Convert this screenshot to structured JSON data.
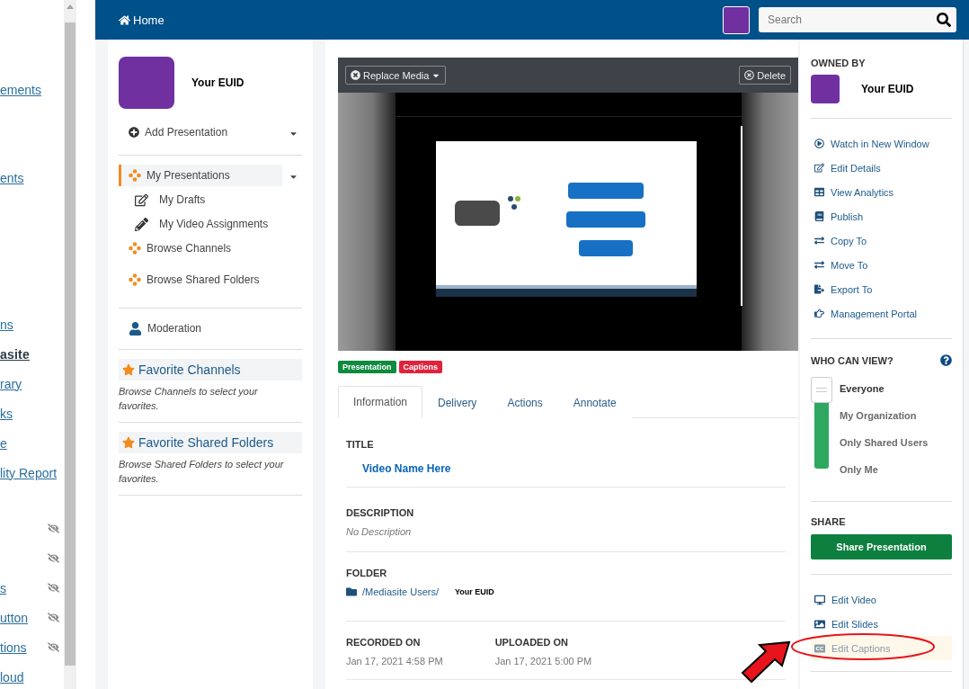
{
  "course_nav": {
    "items": [
      {
        "text": "ements",
        "selected": false,
        "hidden": false
      },
      {
        "text": "ents",
        "selected": false,
        "hidden": false
      },
      {
        "text": "ns",
        "selected": false,
        "hidden": false
      },
      {
        "text": "asite",
        "selected": true,
        "hidden": false
      },
      {
        "text": "rary",
        "selected": false,
        "hidden": false
      },
      {
        "text": "ks",
        "selected": false,
        "hidden": false
      },
      {
        "text": "e",
        "selected": false,
        "hidden": false
      },
      {
        "text": "lity Report",
        "selected": false,
        "hidden": false
      },
      {
        "hidden": true
      },
      {
        "hidden": true
      },
      {
        "text": "s",
        "selected": false,
        "hidden": true
      },
      {
        "text": "utton",
        "selected": false,
        "hidden": true
      },
      {
        "text": "tions",
        "selected": false,
        "hidden": true
      },
      {
        "text": "loud",
        "selected": false,
        "hidden": false
      }
    ]
  },
  "header": {
    "home": "Home",
    "search": {
      "placeholder": "Search"
    }
  },
  "left_panel": {
    "user": {
      "name": "Your EUID"
    },
    "sections": [
      [
        {
          "label": "Add Presentation",
          "kind": "add",
          "dropdown": true,
          "selected": false
        }
      ],
      [
        {
          "label": "My Presentations",
          "kind": "channel",
          "dropdown": true,
          "selected": true,
          "children": [
            {
              "label": "My Drafts",
              "kind": "draft",
              "selected": false
            },
            {
              "label": "My Video Assignments",
              "kind": "assignment",
              "selected": false
            }
          ]
        },
        {
          "label": "Browse Channels",
          "kind": "channel",
          "dropdown": false,
          "selected": false
        },
        {
          "label": "Browse Shared Folders",
          "kind": "channel",
          "dropdown": false,
          "selected": false
        }
      ],
      [
        {
          "label": "Moderation",
          "kind": "person",
          "dropdown": false,
          "selected": false
        }
      ]
    ],
    "favorites": [
      {
        "title": "Favorite Channels",
        "hint": "Browse Channels to select your favorites."
      },
      {
        "title": "Favorite Shared Folders",
        "hint": "Browse Shared Folders to select your favorites."
      }
    ]
  },
  "media": {
    "replace_button": "Replace Media",
    "delete_button": "Delete",
    "tags": [
      {
        "label": "Presentation",
        "color": "#0f8a3e"
      },
      {
        "label": "Captions",
        "color": "#e0223c"
      }
    ]
  },
  "tabs": [
    {
      "label": "Information",
      "selected": true
    },
    {
      "label": "Delivery",
      "selected": false
    },
    {
      "label": "Actions",
      "selected": false
    },
    {
      "label": "Annotate",
      "selected": false
    }
  ],
  "details": {
    "title": {
      "label": "TITLE",
      "value": "Video Name Here"
    },
    "description": {
      "label": "DESCRIPTION",
      "value": "No Description"
    },
    "folder": {
      "label": "FOLDER",
      "path": "/Mediasite Users/",
      "name": "Your EUID"
    },
    "dates": [
      {
        "label": "RECORDED ON",
        "value": "Jan 17, 2021 4:58 PM"
      },
      {
        "label": "UPLOADED ON",
        "value": "Jan 17, 2021 5:00 PM"
      }
    ]
  },
  "right_panel": {
    "owned_by": {
      "label": "OWNED BY",
      "name": "Your EUID"
    },
    "actions": [
      "Watch in New Window",
      "Edit Details",
      "View Analytics",
      "Publish",
      "Copy To",
      "Move To",
      "Export To",
      "Management Portal"
    ],
    "who_can_view": {
      "label": "WHO CAN VIEW?",
      "level": 1,
      "options": [
        {
          "label": "Everyone",
          "selected": true
        },
        {
          "label": "My Organization",
          "selected": false
        },
        {
          "label": "Only Shared Users",
          "selected": false
        },
        {
          "label": "Only Me",
          "selected": false
        }
      ]
    },
    "share": {
      "label": "SHARE",
      "button": "Share Presentation"
    },
    "edit_links": [
      {
        "label": "Edit Video",
        "highlighted": false
      },
      {
        "label": "Edit Slides",
        "highlighted": false
      },
      {
        "label": "Edit Captions",
        "highlighted": true
      }
    ]
  }
}
